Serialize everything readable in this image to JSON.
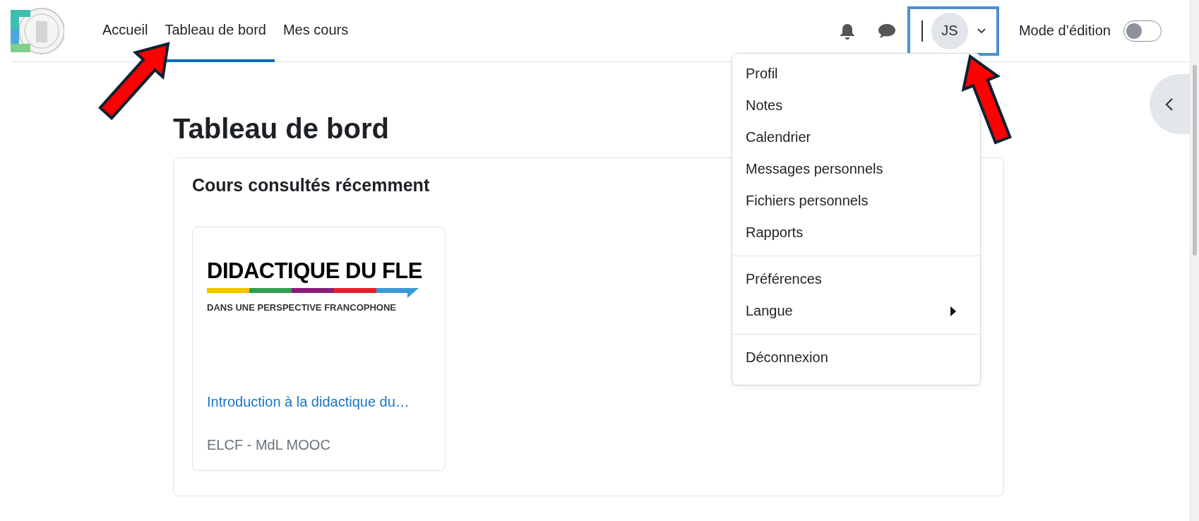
{
  "nav": {
    "items": [
      {
        "label": "Accueil",
        "selected": false
      },
      {
        "label": "Tableau de bord",
        "selected": true
      },
      {
        "label": "Mes cours",
        "selected": false
      }
    ]
  },
  "user_menu": {
    "initials": "JS",
    "expanded": true,
    "groups": [
      {
        "items": [
          {
            "label": "Profil",
            "has_submenu": false
          },
          {
            "label": "Notes",
            "has_submenu": false
          },
          {
            "label": "Calendrier",
            "has_submenu": false
          },
          {
            "label": "Messages personnels",
            "has_submenu": false
          },
          {
            "label": "Fichiers personnels",
            "has_submenu": false
          },
          {
            "label": "Rapports",
            "has_submenu": false
          }
        ]
      },
      {
        "items": [
          {
            "label": "Préférences",
            "has_submenu": false
          },
          {
            "label": "Langue",
            "has_submenu": true
          }
        ]
      },
      {
        "items": [
          {
            "label": "Déconnexion",
            "has_submenu": false
          }
        ]
      }
    ]
  },
  "edit_mode": {
    "label": "Mode d’édition",
    "on": false
  },
  "page_title": "Tableau de bord",
  "recent_courses": {
    "title": "Cours consultés récemment",
    "courses": [
      {
        "image_title": "DIDACTIQUE DU FLE",
        "image_subtitle": "DANS UNE PERSPECTIVE FRANCOPHONE",
        "name": "Introduction à la didactique du…",
        "category": "ELCF - MdL MOOC"
      }
    ]
  }
}
